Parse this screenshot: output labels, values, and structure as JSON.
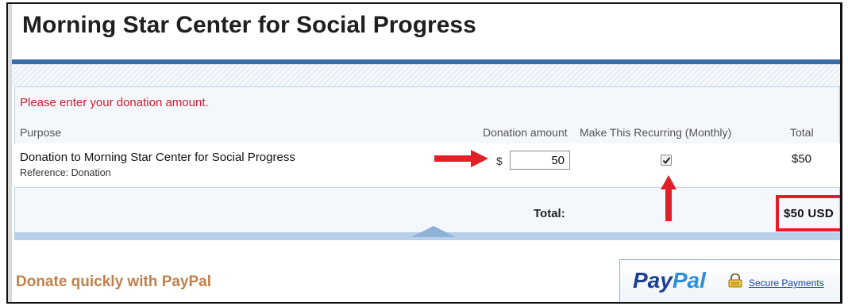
{
  "page": {
    "title": "Morning Star Center for Social Progress"
  },
  "form": {
    "error_message": "Please enter your donation amount.",
    "columns": {
      "purpose": "Purpose",
      "donation_amount": "Donation amount",
      "recurring": "Make This Recurring (Monthly)",
      "total": "Total"
    },
    "item": {
      "name": "Donation to Morning Star Center for Social Progress",
      "reference": "Reference: Donation",
      "currency_symbol": "$",
      "amount": "50",
      "recurring_checked": true,
      "line_total": "$50"
    },
    "total_label": "Total:",
    "total_value": "$50 USD"
  },
  "paypal": {
    "heading": "Donate quickly with PayPal",
    "logo_pay": "Pay",
    "logo_pal": "Pal",
    "secure_link": "Secure Payments"
  },
  "colors": {
    "error_red": "#d11b2b",
    "annotation_red": "#e21f26",
    "header_blue": "#3c6ca8",
    "paypal_dark": "#1b3f8f",
    "paypal_light": "#2e8fd8",
    "donate_orange": "#c0804a"
  },
  "icons": {
    "checkbox": "checkmark-icon",
    "lock": "lock-icon",
    "arrows": [
      "arrow-right-icon",
      "arrow-up-icon"
    ]
  }
}
